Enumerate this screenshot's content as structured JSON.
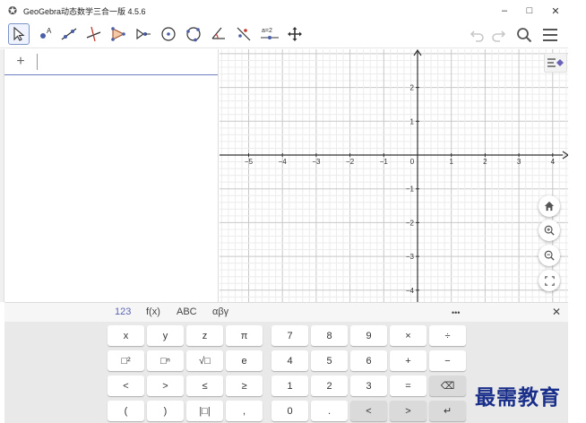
{
  "window": {
    "title": "GeoGebra动态数学三合一版 4.5.6",
    "app_icon": "geogebra-icon",
    "minimize": "–",
    "maximize": "□",
    "close": "✕"
  },
  "toolbar": {
    "tools": [
      "move",
      "point",
      "line",
      "perpendicular",
      "polygon",
      "reflect",
      "circle-center",
      "circle-three-points",
      "angle",
      "reflect-line",
      "slider",
      "move-view"
    ],
    "slider_label": "a=2",
    "active_tool": "move"
  },
  "algebra": {
    "add_symbol": "+",
    "input_value": "",
    "input_placeholder": ""
  },
  "graphics": {
    "x_ticks": [
      "−5",
      "−4",
      "−3",
      "−2",
      "−1",
      "0",
      "1",
      "2",
      "3",
      "4"
    ],
    "y_ticks_pos": [
      "2",
      "1"
    ],
    "y_ticks_neg": [
      "−1",
      "−2",
      "−3",
      "−4"
    ],
    "axis_color": "#333333",
    "grid_major_color": "#c8c8c8",
    "grid_minor_color": "#ececec"
  },
  "keyboard": {
    "tabs": [
      "123",
      "f(x)",
      "ABC",
      "αβγ"
    ],
    "more": "•••",
    "close": "✕",
    "rows": [
      [
        "x",
        "y",
        "z",
        "π",
        "7",
        "8",
        "9",
        "×",
        "÷"
      ],
      [
        "□²",
        "□ⁿ",
        "√□",
        "e",
        "4",
        "5",
        "6",
        "+",
        "−"
      ],
      [
        "<",
        ">",
        "≤",
        "≥",
        "1",
        "2",
        "3",
        "=",
        "⌫"
      ],
      [
        "(",
        ")",
        "|□|",
        ",",
        "0",
        ".",
        "<",
        ">",
        "↵"
      ]
    ]
  },
  "watermark": "最需教育"
}
